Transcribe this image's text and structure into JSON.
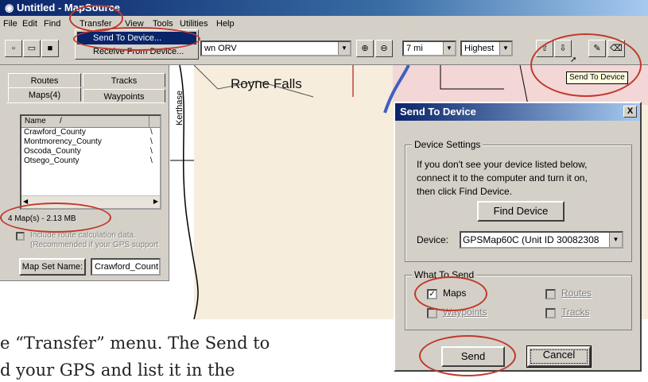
{
  "window": {
    "title": "Untitled - MapSource"
  },
  "menubar": [
    "File",
    "Edit",
    "Find",
    "Transfer",
    "View",
    "Tools",
    "Utilities",
    "Help"
  ],
  "transfer_menu": {
    "send": "Send To Device...",
    "receive": "Receive From Device..."
  },
  "toolbar": {
    "map_combo": "wn ORV",
    "zoom_combo": "7 mi",
    "detail_combo": "Highest",
    "tooltip": "Send To Device"
  },
  "left_panel": {
    "tabs": [
      "Routes",
      "Tracks",
      "Maps(4)",
      "Waypoints"
    ],
    "list_header": "Name",
    "header_sort": "/",
    "maps": [
      "Crawford_County",
      "Montmorency_County",
      "Oscoda_County",
      "Otsego_County"
    ],
    "col2_mark": "\\",
    "summary": "4 Map(s) - 2.13 MB",
    "include_route_line1": "Include route calculation data.",
    "include_route_line2": "(Recommended if your GPS support",
    "map_set_button": "Map Set Name:",
    "map_set_value": "Crawford_Count"
  },
  "map": {
    "label_falls": "Royne Falls",
    "label_kerthase": "Kerthase"
  },
  "dialog": {
    "title": "Send To Device",
    "close": "X",
    "device_settings": {
      "label": "Device Settings",
      "instructions": [
        "If you don't see your device listed below,",
        "connect it to the computer and turn it on,",
        "then click Find Device."
      ],
      "find_button": "Find Device",
      "device_label": "Device:",
      "device_value": "GPSMap60C (Unit ID 30082308"
    },
    "what_to_send": {
      "label": "What To Send",
      "maps": "Maps",
      "waypoints": "Waypoints",
      "routes": "Routes",
      "tracks": "Tracks"
    },
    "send_button": "Send",
    "cancel_button": "Cancel"
  },
  "caption": {
    "line1": "e “Transfer” menu. The Send to",
    "line2": "d your GPS and list it in the"
  },
  "colors": {
    "highlight": "#0a246a",
    "annotation": "#c0392b",
    "face": "#d4d0c8"
  }
}
